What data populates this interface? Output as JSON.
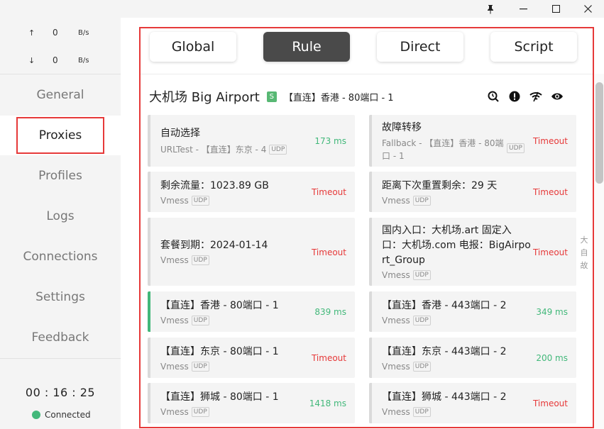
{
  "titlebar": {
    "pin": "📌",
    "minimize": "─",
    "maximize": "☐",
    "close": "✕"
  },
  "traffic": {
    "up_arrow": "↑",
    "up_value": "0",
    "up_unit": "B/s",
    "down_arrow": "↓",
    "down_value": "0",
    "down_unit": "B/s"
  },
  "nav": {
    "items": [
      {
        "label": "General"
      },
      {
        "label": "Proxies"
      },
      {
        "label": "Profiles"
      },
      {
        "label": "Logs"
      },
      {
        "label": "Connections"
      },
      {
        "label": "Settings"
      },
      {
        "label": "Feedback"
      }
    ],
    "active": "Proxies"
  },
  "clock": {
    "time": "00 : 16 : 25",
    "status": "Connected"
  },
  "modes": [
    {
      "label": "Global"
    },
    {
      "label": "Rule"
    },
    {
      "label": "Direct"
    },
    {
      "label": "Script"
    }
  ],
  "active_mode": "Rule",
  "group": {
    "name": "大机场 Big Airport",
    "badge": "S",
    "current": "【直连】香港 - 80端口 - 1",
    "icons": [
      "search-latency-icon",
      "info-icon",
      "wifi-test-icon",
      "eye-icon"
    ]
  },
  "proxies": [
    {
      "name": "自动选择",
      "type": "URLTest - 【直连】东京 - 4",
      "udp": "UDP",
      "delay": "173 ms"
    },
    {
      "name": "故障转移",
      "type_line1": "Fallback - 【直连】香港 - 80端",
      "type_line2": "口 - 1",
      "udp": "UDP",
      "delay": "Timeout"
    },
    {
      "name": "剩余流量：1023.89 GB",
      "type": "Vmess",
      "udp": "UDP",
      "delay": "Timeout"
    },
    {
      "name": "距离下次重置剩余：29 天",
      "type": "Vmess",
      "udp": "UDP",
      "delay": "Timeout"
    },
    {
      "name": "套餐到期：2024-01-14",
      "type": "Vmess",
      "udp": "UDP",
      "delay": "Timeout"
    },
    {
      "name_line1": "国内入口：大机场.art 固定入",
      "name_line2": "口：大机场.com 电报：BigAirpo",
      "name_line3": "rt_Group",
      "type": "Vmess",
      "udp": "UDP",
      "delay": "Timeout"
    },
    {
      "name": "【直连】香港 - 80端口 - 1",
      "type": "Vmess",
      "udp": "UDP",
      "delay": "839 ms"
    },
    {
      "name": "【直连】香港 - 443端口 - 2",
      "type": "Vmess",
      "udp": "UDP",
      "delay": "349 ms"
    },
    {
      "name": "【直连】东京 - 80端口 - 1",
      "type": "Vmess",
      "udp": "UDP",
      "delay": "Timeout"
    },
    {
      "name": "【直连】东京 - 443端口 - 2",
      "type": "Vmess",
      "udp": "UDP",
      "delay": "200 ms"
    },
    {
      "name": "【直连】狮城 - 80端口 - 1",
      "type": "Vmess",
      "udp": "UDP",
      "delay": "1418 ms"
    },
    {
      "name": "【直连】狮城 - 443端口 - 2",
      "type": "Vmess",
      "udp": "UDP",
      "delay": "Timeout"
    }
  ],
  "side_index": {
    "c1": "大",
    "c2": "自",
    "c3": "故"
  },
  "colors": {
    "accent_red": "#e63939",
    "ok_green": "#42b87a",
    "active_mode_bg": "#4a4a4a"
  }
}
